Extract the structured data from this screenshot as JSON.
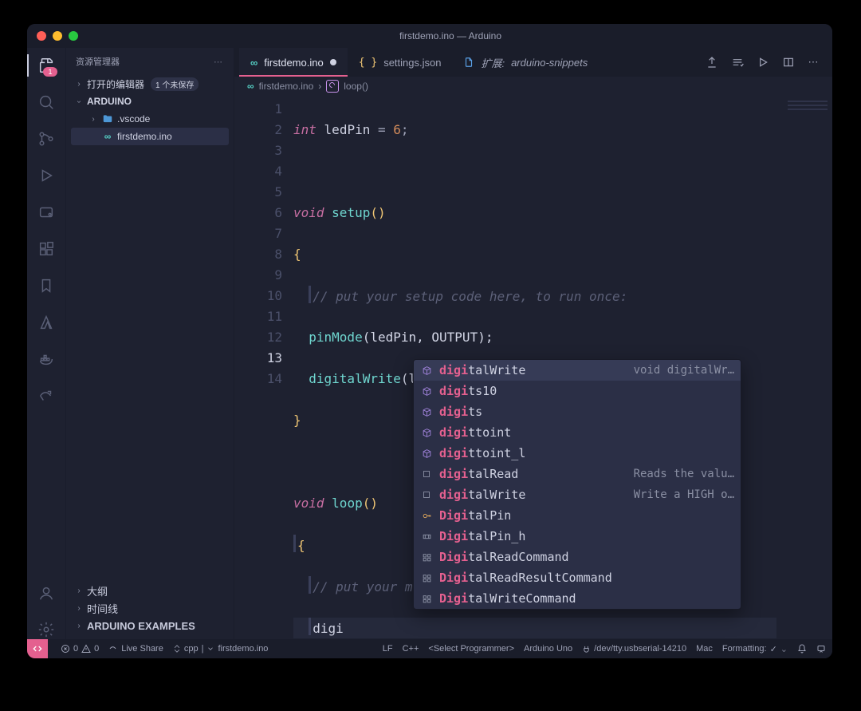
{
  "title": "firstdemo.ino — Arduino",
  "sidebar": {
    "header": "资源管理器",
    "open_editors": "打开的编辑器",
    "open_editors_badge": "1 个未保存",
    "project": "ARDUINO",
    "folder_vscode": ".vscode",
    "file_main": "firstdemo.ino",
    "outline": "大纲",
    "timeline": "时间线",
    "examples": "ARDUINO EXAMPLES"
  },
  "tabs": {
    "t0": "firstdemo.ino",
    "t1": "settings.json",
    "t2_prefix": "扩展: ",
    "t2": "arduino-snippets"
  },
  "crumbs": {
    "file": "firstdemo.ino",
    "fn": "loop()"
  },
  "code": {
    "lines": [
      {
        "n": "1"
      },
      {
        "n": "2"
      },
      {
        "n": "3"
      },
      {
        "n": "4"
      },
      {
        "n": "5"
      },
      {
        "n": "6"
      },
      {
        "n": "7"
      },
      {
        "n": "8"
      },
      {
        "n": "9"
      },
      {
        "n": "10"
      },
      {
        "n": "11"
      },
      {
        "n": "12"
      },
      {
        "n": "13"
      },
      {
        "n": "14"
      }
    ],
    "l1_type": "int",
    "l1_id": "ledPin",
    "l1_eq": " = ",
    "l1_num": "6",
    "l1_sc": ";",
    "l3_kw": "void",
    "l3_fn": "setup",
    "l3_p": "()",
    "l4": "{",
    "l5_cm": "// put your setup code here, to run once:",
    "l6_fn": "pinMode",
    "l6_args": "(ledPin, OUTPUT);",
    "l7_fn": "digitalWrite",
    "l7_args": "(ledPin, HIGH);",
    "l8": "}",
    "l10_kw": "void",
    "l10_fn": "loop",
    "l10_p": "()",
    "l11": "{",
    "l12_cm": "// put your main code here, to run repeatedly:",
    "l13_txt": "digi",
    "l14": "}"
  },
  "ac": {
    "items": [
      {
        "match": "digi",
        "rest": "talWrite",
        "hint": "void digitalWr…",
        "k": "cube",
        "sel": true
      },
      {
        "match": "digi",
        "rest": "ts10",
        "hint": "",
        "k": "cube"
      },
      {
        "match": "digi",
        "rest": "ts",
        "hint": "",
        "k": "cube"
      },
      {
        "match": "digi",
        "rest": "ttoint",
        "hint": "",
        "k": "cube"
      },
      {
        "match": "digi",
        "rest": "ttoint_l",
        "hint": "",
        "k": "cube"
      },
      {
        "match": "digi",
        "rest": "talRead",
        "hint": "Reads the valu…",
        "k": "sq"
      },
      {
        "match": "digi",
        "rest": "talWrite",
        "hint": "Write a HIGH o…",
        "k": "sq"
      },
      {
        "match": "Digi",
        "rest": "talPin",
        "hint": "",
        "k": "key"
      },
      {
        "match": "Digi",
        "rest": "talPin_h",
        "hint": "",
        "k": "block"
      },
      {
        "match": "Digi",
        "rest": "talReadCommand",
        "hint": "",
        "k": "struct"
      },
      {
        "match": "Digi",
        "rest": "talReadResultCommand",
        "hint": "",
        "k": "struct"
      },
      {
        "match": "Digi",
        "rest": "talWriteCommand",
        "hint": "",
        "k": "struct"
      }
    ]
  },
  "status": {
    "errors": "0",
    "warnings": "0",
    "liveshare": "Live Share",
    "lang_sel": "cpp",
    "lang_suffix": " | ",
    "file": "firstdemo.ino",
    "eol": "LF",
    "lang": "C++",
    "programmer": "<Select Programmer>",
    "board": "Arduino Uno",
    "port": "/dev/tty.usbserial-14210",
    "os": "Mac",
    "formatting": "Formatting: ",
    "check": "✓"
  }
}
